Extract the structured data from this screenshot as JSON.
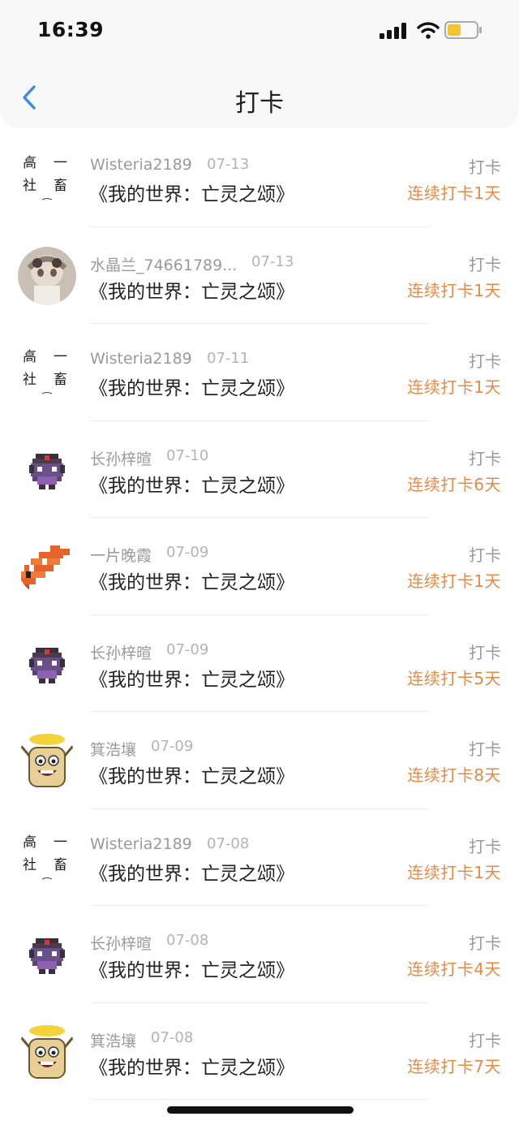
{
  "status_bar": {
    "time": "16:39",
    "signal_icon": "signal-icon",
    "wifi_icon": "wifi-icon",
    "battery_icon": "battery-icon",
    "battery_color": "#f3c431"
  },
  "nav": {
    "back_icon": "chevron-left-icon",
    "title": "打卡",
    "accent": "#3b8be5"
  },
  "colors": {
    "streak": "#e88a45",
    "muted": "#9a9a9a"
  },
  "entries": [
    {
      "username": "Wisteria2189",
      "date": "07-13",
      "book": "《我的世界：亡灵之颂》",
      "action": "打卡",
      "streak": "连续打卡1天",
      "avatar": "calligraphy-avatar"
    },
    {
      "username": "水晶兰_74661789...",
      "date": "07-13",
      "book": "《我的世界：亡灵之颂》",
      "action": "打卡",
      "streak": "连续打卡1天",
      "avatar": "anime-girl-avatar"
    },
    {
      "username": "Wisteria2189",
      "date": "07-11",
      "book": "《我的世界：亡灵之颂》",
      "action": "打卡",
      "streak": "连续打卡1天",
      "avatar": "calligraphy-avatar"
    },
    {
      "username": "长孙梓暄",
      "date": "07-10",
      "book": "《我的世界：亡灵之颂》",
      "action": "打卡",
      "streak": "连续打卡6天",
      "avatar": "pixel-knight-avatar"
    },
    {
      "username": "一片晚霞",
      "date": "07-09",
      "book": "《我的世界：亡灵之颂》",
      "action": "打卡",
      "streak": "连续打卡1天",
      "avatar": "pixel-fish-avatar"
    },
    {
      "username": "长孙梓暄",
      "date": "07-09",
      "book": "《我的世界：亡灵之颂》",
      "action": "打卡",
      "streak": "连续打卡5天",
      "avatar": "pixel-knight-avatar"
    },
    {
      "username": "箕浩壤",
      "date": "07-09",
      "book": "《我的世界：亡灵之颂》",
      "action": "打卡",
      "streak": "连续打卡8天",
      "avatar": "cartoon-face-avatar"
    },
    {
      "username": "Wisteria2189",
      "date": "07-08",
      "book": "《我的世界：亡灵之颂》",
      "action": "打卡",
      "streak": "连续打卡1天",
      "avatar": "calligraphy-avatar"
    },
    {
      "username": "长孙梓暄",
      "date": "07-08",
      "book": "《我的世界：亡灵之颂》",
      "action": "打卡",
      "streak": "连续打卡4天",
      "avatar": "pixel-knight-avatar"
    },
    {
      "username": "箕浩壤",
      "date": "07-08",
      "book": "《我的世界：亡灵之颂》",
      "action": "打卡",
      "streak": "连续打卡7天",
      "avatar": "cartoon-face-avatar"
    }
  ]
}
